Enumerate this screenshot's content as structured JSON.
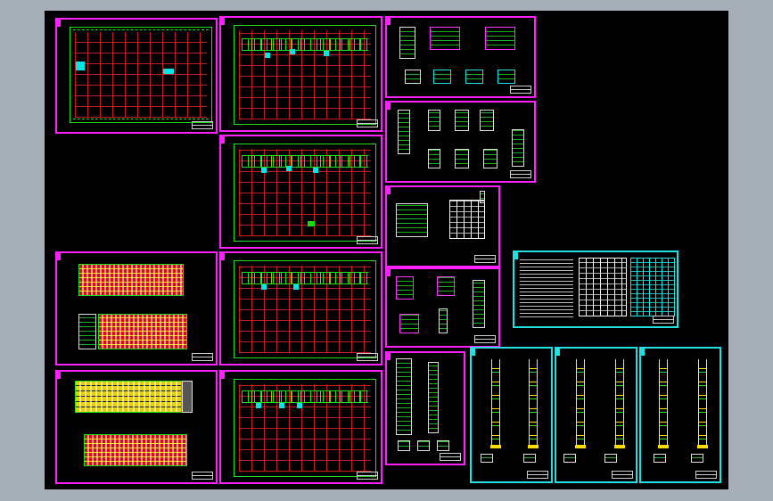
{
  "viewport": {
    "background": "#a6aeb7",
    "canvas_background": "#000000"
  },
  "colors": {
    "sheet_border": "#ff22ff",
    "sheet_border_alt": "#22e0e0",
    "axis_grid": "#ff2828",
    "wall": "#22dd22",
    "highlight": "#00e5e5",
    "text": "#dddddd"
  },
  "sheets": [
    {
      "id": "plan-site",
      "type": "floor-plan"
    },
    {
      "id": "plan-floor-1",
      "type": "floor-plan"
    },
    {
      "id": "plan-floor-2",
      "type": "floor-plan"
    },
    {
      "id": "plan-floor-3",
      "type": "floor-plan"
    },
    {
      "id": "plan-roof",
      "type": "floor-plan"
    },
    {
      "id": "elevation-front-back",
      "type": "elevation"
    },
    {
      "id": "elevation-side",
      "type": "elevation"
    },
    {
      "id": "details-a",
      "type": "detail"
    },
    {
      "id": "details-b",
      "type": "detail"
    },
    {
      "id": "section-a",
      "type": "section"
    },
    {
      "id": "details-c",
      "type": "detail"
    },
    {
      "id": "wall-section",
      "type": "detail"
    },
    {
      "id": "notes-schedule",
      "type": "schedule"
    },
    {
      "id": "stair-1",
      "type": "stair"
    },
    {
      "id": "stair-2",
      "type": "stair"
    },
    {
      "id": "stair-3",
      "type": "stair"
    }
  ]
}
